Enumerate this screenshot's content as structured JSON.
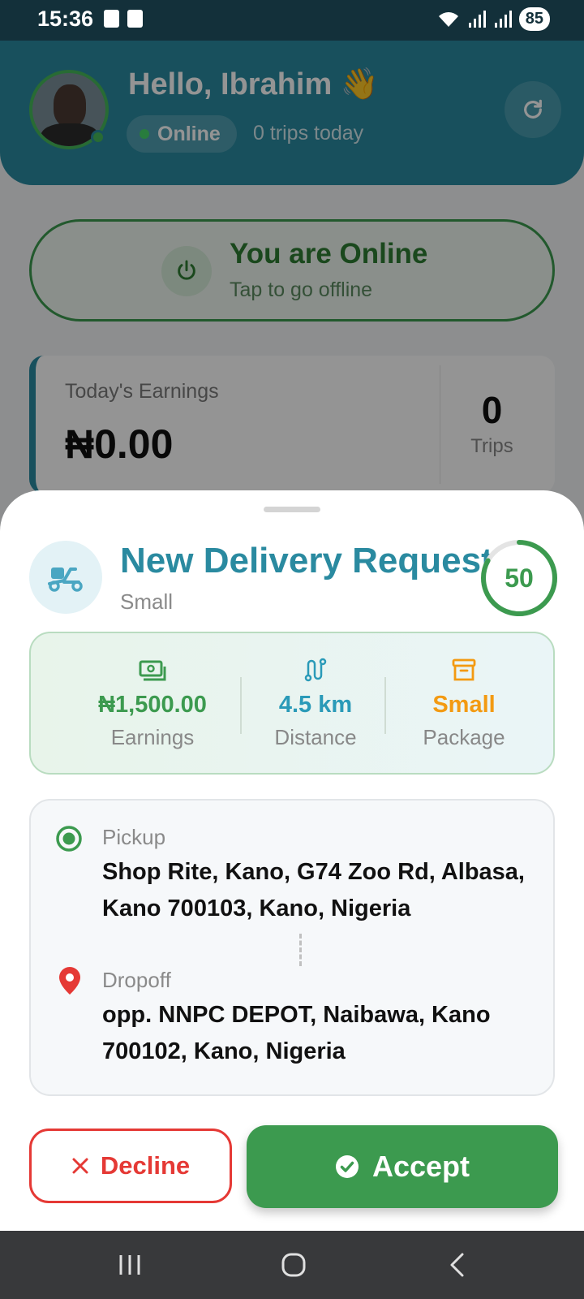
{
  "status_bar": {
    "time": "15:36",
    "battery": "85"
  },
  "header": {
    "greeting": "Hello, Ibrahim 👋",
    "status": "Online",
    "trips_today": "0 trips today"
  },
  "online_toggle": {
    "title": "You are Online",
    "subtitle": "Tap to go offline"
  },
  "earnings": {
    "label": "Today's Earnings",
    "value": "₦0.00",
    "trips_value": "0",
    "trips_label": "Trips"
  },
  "request": {
    "title": "New Delivery Request",
    "subtitle": "Small",
    "countdown": "50",
    "countdown_fraction": 0.83,
    "stats": [
      {
        "value": "₦1,500.00",
        "label": "Earnings",
        "color": "#3c9a4f",
        "icon": "cash-icon"
      },
      {
        "value": "4.5 km",
        "label": "Distance",
        "color": "#2a9ab8",
        "icon": "route-icon"
      },
      {
        "value": "Small",
        "label": "Package",
        "color": "#f39a12",
        "icon": "package-icon"
      }
    ],
    "pickup": {
      "label": "Pickup",
      "address": "Shop Rite, Kano, G74 Zoo Rd, Albasa, Kano 700103, Kano, Nigeria"
    },
    "dropoff": {
      "label": "Dropoff",
      "address": "opp. NNPC DEPOT, Naibawa, Kano 700102, Kano, Nigeria"
    },
    "decline_label": "Decline",
    "accept_label": "Accept"
  },
  "colors": {
    "brand": "#2a8aa0",
    "success": "#3c9a4f",
    "danger": "#e53935",
    "warning": "#f39a12"
  }
}
